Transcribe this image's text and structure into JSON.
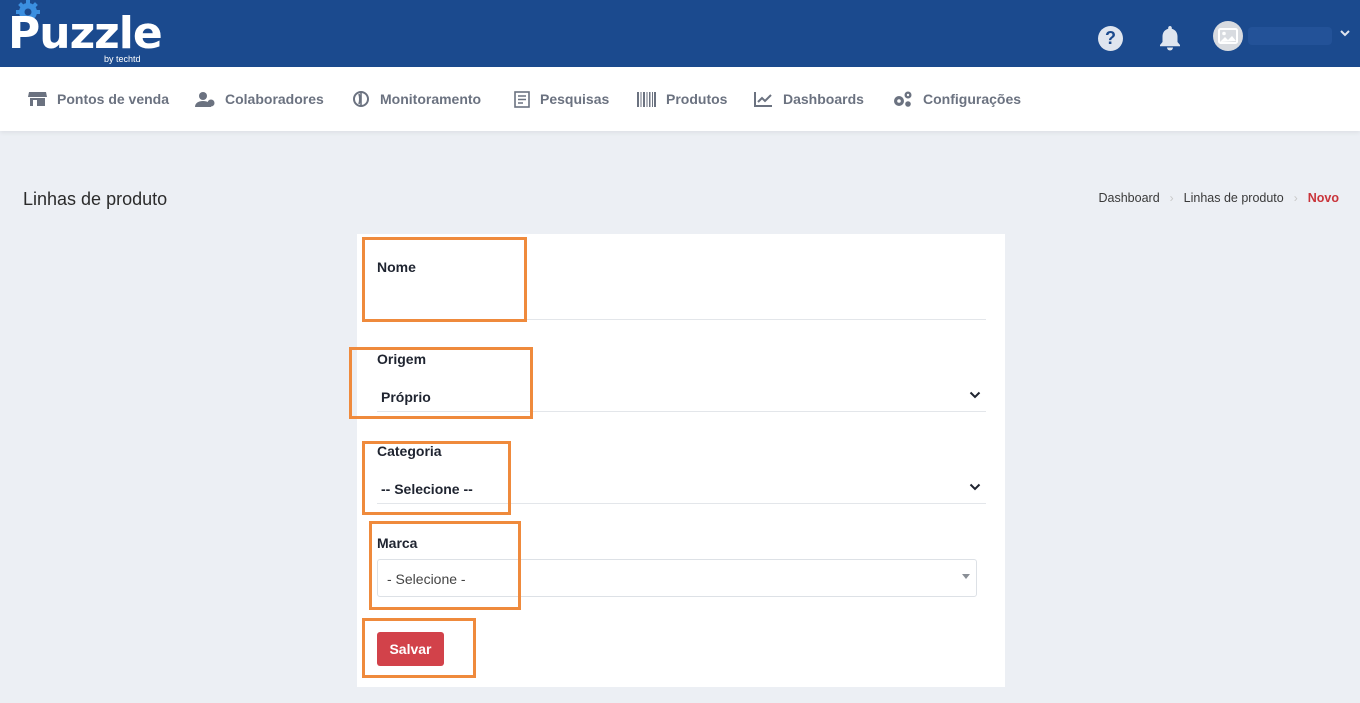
{
  "header": {
    "logo_text": "Puzzle",
    "logo_sub": "by techtd",
    "help_label": "?",
    "colors": {
      "bar": "#1b4a8e",
      "accent_red": "#d2424a",
      "highlight": "#ef8a3c"
    }
  },
  "nav": {
    "items": [
      {
        "label": "Pontos de venda",
        "icon": "store-icon"
      },
      {
        "label": "Colaboradores",
        "icon": "users-icon"
      },
      {
        "label": "Monitoramento",
        "icon": "globe-icon"
      },
      {
        "label": "Pesquisas",
        "icon": "survey-icon"
      },
      {
        "label": "Produtos",
        "icon": "barcode-icon"
      },
      {
        "label": "Dashboards",
        "icon": "chart-icon"
      },
      {
        "label": "Configurações",
        "icon": "gears-icon"
      }
    ]
  },
  "page": {
    "title": "Linhas de produto",
    "breadcrumb": [
      "Dashboard",
      "Linhas de produto",
      "Novo"
    ]
  },
  "form": {
    "nome": {
      "label": "Nome",
      "value": ""
    },
    "origem": {
      "label": "Origem",
      "value": "Próprio"
    },
    "categoria": {
      "label": "Categoria",
      "value": "-- Selecione --"
    },
    "marca": {
      "label": "Marca",
      "value": "- Selecione -"
    },
    "save_label": "Salvar"
  }
}
